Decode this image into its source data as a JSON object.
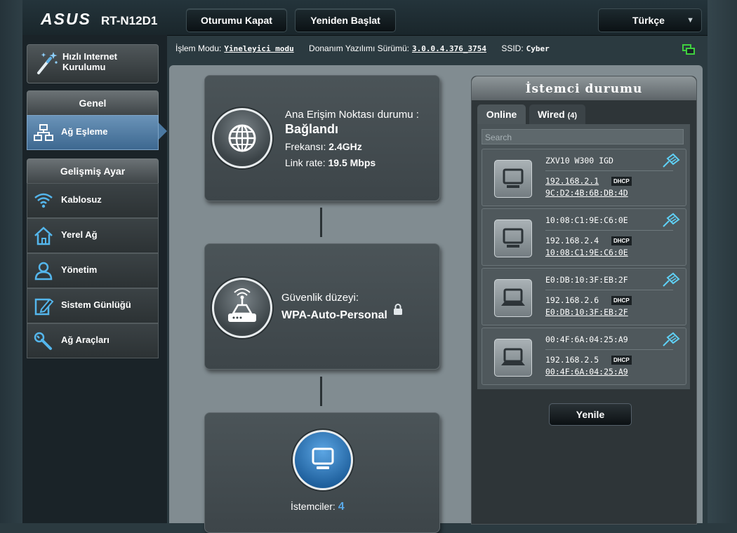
{
  "header": {
    "logo": "ASUS",
    "model": "RT-N12D1",
    "logout_label": "Oturumu Kapat",
    "reboot_label": "Yeniden Başlat",
    "language": "Türkçe"
  },
  "sidebar": {
    "quick_setup": "Hızlı Internet Kurulumu",
    "general_header": "Genel",
    "general_items": [
      {
        "label": "Ağ Eşleme",
        "icon": "network-map-icon",
        "active": true
      }
    ],
    "advanced_header": "Gelişmiş Ayar",
    "advanced_items": [
      {
        "label": "Kablosuz",
        "icon": "wifi-icon"
      },
      {
        "label": "Yerel Ağ",
        "icon": "home-icon"
      },
      {
        "label": "Yönetim",
        "icon": "admin-user-icon"
      },
      {
        "label": "Sistem Günlüğü",
        "icon": "log-edit-icon"
      },
      {
        "label": "Ağ Araçları",
        "icon": "tools-icon"
      }
    ]
  },
  "infobar": {
    "mode_label": "İşlem Modu:",
    "mode_value": "Yineleyici modu",
    "firmware_label": "Donanım Yazılımı Sürümü:",
    "firmware_value": "3.0.0.4.376_3754",
    "ssid_label": "SSID:",
    "ssid_value": "Cyber"
  },
  "ap_card": {
    "title": "Ana Erişim Noktası durumu :",
    "status": "Bağlandı",
    "freq_label": "Frekansı:",
    "freq_value": "2.4GHz",
    "link_label": "Link rate:",
    "link_value": "19.5 Mbps"
  },
  "security_card": {
    "title": "Güvenlik düzeyi:",
    "value": "WPA-Auto-Personal"
  },
  "clients_card": {
    "label": "İstemciler:",
    "count": "4"
  },
  "client_panel": {
    "title": "İstemci durumu",
    "tab_online": "Online",
    "tab_wired": "Wired",
    "tab_wired_count": "(4)",
    "search_placeholder": "Search",
    "clients": [
      {
        "name": "ZXV10 W300 IGD",
        "ip": "192.168.2.1",
        "ip_underlined": true,
        "badge": "DHCP",
        "mac": "9C:D2:4B:6B:DB:4D"
      },
      {
        "name": "10:08:C1:9E:C6:0E",
        "ip": "192.168.2.4",
        "ip_underlined": false,
        "badge": "DHCP",
        "mac": "10:08:C1:9E:C6:0E"
      },
      {
        "name": "E0:DB:10:3F:EB:2F",
        "ip": "192.168.2.6",
        "ip_underlined": false,
        "badge": "DHCP",
        "mac": "E0:DB:10:3F:EB:2F"
      },
      {
        "name": "00:4F:6A:04:25:A9",
        "ip": "192.168.2.5",
        "ip_underlined": false,
        "badge": "DHCP",
        "mac": "00:4F:6A:04:25:A9"
      }
    ],
    "refresh_label": "Yenile"
  },
  "colors": {
    "accent_blue": "#4b78a0",
    "status_green": "#3fcf3f",
    "count_blue": "#5aa9e8"
  }
}
